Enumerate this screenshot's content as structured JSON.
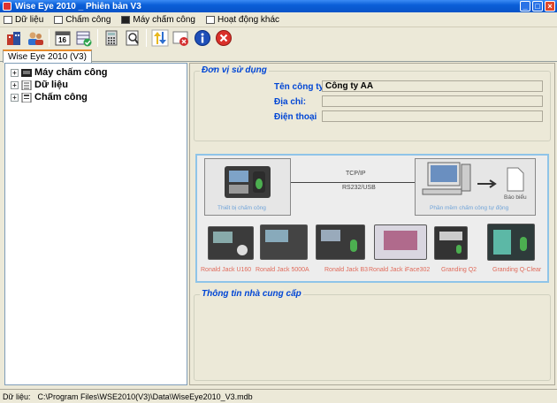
{
  "window": {
    "title": "Wise Eye 2010 _ Phiên bản V3"
  },
  "menu": [
    {
      "label": "Dữ liệu",
      "icon": "data-icon"
    },
    {
      "label": "Chấm công",
      "icon": "timesheet-icon"
    },
    {
      "label": "Máy chấm công",
      "icon": "device-icon"
    },
    {
      "label": "Hoạt động khác",
      "icon": "other-icon"
    }
  ],
  "toolbar_icons": [
    "company-icon",
    "users-icon",
    "calendar-icon",
    "check-calendar-icon",
    "calculator-icon",
    "search-icon",
    "transfer-icon",
    "delete-card-icon",
    "info-icon",
    "exit-icon"
  ],
  "tab": {
    "label": "Wise Eye 2010 (V3)"
  },
  "tree": [
    {
      "label": "Máy chấm công",
      "icon": "device-icon"
    },
    {
      "label": "Dữ liệu",
      "icon": "data-icon"
    },
    {
      "label": "Chấm công",
      "icon": "timesheet-icon"
    }
  ],
  "org": {
    "section_title": "Đơn vị sử dụng",
    "company_label": "Tên công ty:",
    "company_value": "Công ty AA",
    "address_label": "Địa chỉ:",
    "address_value": "",
    "phone_label": "Điện thoại",
    "phone_value": ""
  },
  "diagram": {
    "protocol_top": "TCP/IP",
    "protocol_bottom": "RS232/USB",
    "device_caption": "Thiết bị chấm công",
    "software_caption": "Phần mềm chấm công tự động",
    "report_caption": "Báo biểu",
    "devices": [
      "Ronald Jack U160",
      "Ronald Jack 5000A",
      "Ronald Jack B3",
      "Ronald Jack iFace302",
      "Granding Q2",
      "Granding Q-Clear"
    ]
  },
  "supplier": {
    "section_title": "Thông tin nhà cung cấp"
  },
  "status": {
    "label": "Dữ liệu:",
    "path": "C:\\Program Files\\WSE2010(V3)\\Data\\WiseEye2010_V3.mdb"
  },
  "colors": {
    "titlebar": "#0a5fd8",
    "label_blue": "#0046d5",
    "caption_blue": "#6fa3d8",
    "device_red": "#e06a5a"
  }
}
